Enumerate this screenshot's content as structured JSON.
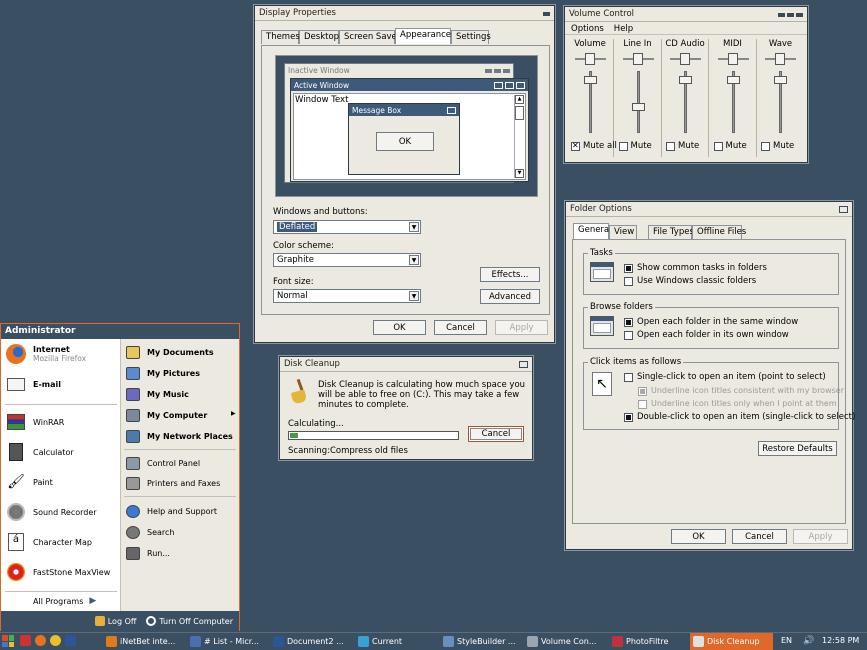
{
  "display_props": {
    "title": "Display Properties",
    "tabs": [
      "Themes",
      "Desktop",
      "Screen Saver",
      "Appearance",
      "Settings"
    ],
    "preview": {
      "inactive": "Inactive Window",
      "active": "Active Window",
      "window_text": "Window Text",
      "msgbox": "Message Box",
      "ok": "OK"
    },
    "windows_buttons_label": "Windows and buttons:",
    "windows_buttons_value": "Deflated",
    "color_scheme_label": "Color scheme:",
    "color_scheme_value": "Graphite",
    "font_size_label": "Font size:",
    "font_size_value": "Normal",
    "effects": "Effects...",
    "advanced": "Advanced",
    "ok": "OK",
    "cancel": "Cancel",
    "apply": "Apply"
  },
  "volume": {
    "title": "Volume Control",
    "menu": [
      "Options",
      "Help"
    ],
    "channels": [
      {
        "name": "Volume",
        "mute": "Mute all",
        "muted": true,
        "level": 0.9
      },
      {
        "name": "Line In",
        "mute": "Mute",
        "muted": false,
        "level": 0.4
      },
      {
        "name": "CD Audio",
        "mute": "Mute",
        "muted": false,
        "level": 0.9
      },
      {
        "name": "MIDI",
        "mute": "Mute",
        "muted": false,
        "level": 0.9
      },
      {
        "name": "Wave",
        "mute": "Mute",
        "muted": false,
        "level": 0.9
      }
    ]
  },
  "folder": {
    "title": "Folder Options",
    "tabs": [
      "General",
      "View",
      "File Types",
      "Offline Files"
    ],
    "tasks": "Tasks",
    "tasks_opt1": "Show common tasks in folders",
    "tasks_opt2": "Use Windows classic folders",
    "browse": "Browse folders",
    "browse_opt1": "Open each folder in the same window",
    "browse_opt2": "Open each folder in its own window",
    "click": "Click items as follows",
    "click_opt1": "Single-click to open an item (point to select)",
    "click_sub1": "Underline icon titles consistent with my browser",
    "click_sub2": "Underline icon titles only when I point at them",
    "click_opt2": "Double-click to open an item (single-click to select)",
    "restore": "Restore Defaults",
    "ok": "OK",
    "cancel": "Cancel",
    "apply": "Apply"
  },
  "disk": {
    "title": "Disk Cleanup",
    "message": "Disk Cleanup is calculating how much space you will be able to free on  (C:). This may take a few minutes to complete.",
    "calculating": "Calculating...",
    "cancel": "Cancel",
    "scanning_label": "Scanning:",
    "scanning_value": "Compress old files",
    "progress": 0.05
  },
  "start_menu": {
    "user": "Administrator",
    "pinned": [
      {
        "label": "Internet",
        "sub": "Mozilla Firefox",
        "icon": "firefox-icon"
      },
      {
        "label": "E-mail",
        "sub": "",
        "icon": "email-icon"
      }
    ],
    "recent": [
      {
        "label": "WinRAR",
        "icon": "winrar-icon"
      },
      {
        "label": "Calculator",
        "icon": "calculator-icon"
      },
      {
        "label": "Paint",
        "icon": "paint-icon"
      },
      {
        "label": "Sound Recorder",
        "icon": "sound-recorder-icon"
      },
      {
        "label": "Character Map",
        "icon": "character-map-icon"
      },
      {
        "label": "FastStone MaxView",
        "icon": "faststone-icon"
      }
    ],
    "all_programs": "All Programs",
    "right": [
      {
        "label": "My Documents",
        "bold": true,
        "icon": "documents-icon"
      },
      {
        "label": "My Pictures",
        "bold": true,
        "icon": "pictures-icon"
      },
      {
        "label": "My Music",
        "bold": true,
        "icon": "music-icon"
      },
      {
        "label": "My Computer",
        "bold": true,
        "icon": "computer-icon"
      },
      {
        "label": "My Network Places",
        "bold": true,
        "icon": "network-icon"
      },
      {
        "label": "Control Panel",
        "bold": false,
        "icon": "control-panel-icon"
      },
      {
        "label": "Printers and Faxes",
        "bold": false,
        "icon": "printer-icon"
      },
      {
        "label": "Help and Support",
        "bold": false,
        "icon": "help-icon"
      },
      {
        "label": "Search",
        "bold": false,
        "icon": "search-icon"
      },
      {
        "label": "Run...",
        "bold": false,
        "icon": "run-icon"
      }
    ],
    "logoff": "Log Off",
    "turnoff": "Turn Off Computer"
  },
  "taskbar": {
    "items": [
      {
        "label": "iNetBet inte...",
        "color": "#e07b1a"
      },
      {
        "label": "# List - Micr...",
        "color": "#4a6fb0"
      },
      {
        "label": "Document2 ...",
        "color": "#2b5797"
      },
      {
        "label": "Current",
        "color": "#3aa0d8"
      },
      {
        "label": "StyleBuilder ...",
        "color": "#6a8fbf"
      },
      {
        "label": "Volume Con...",
        "color": "#9aa5b0"
      },
      {
        "label": "PhotoFiltre",
        "color": "#c03040"
      },
      {
        "label": "Disk Cleanup",
        "color": "#e0e0e0"
      }
    ],
    "lang": "EN",
    "time": "12:58 PM",
    "colors": {
      "bar": "#3b4f63",
      "active": "#e0692a"
    }
  }
}
